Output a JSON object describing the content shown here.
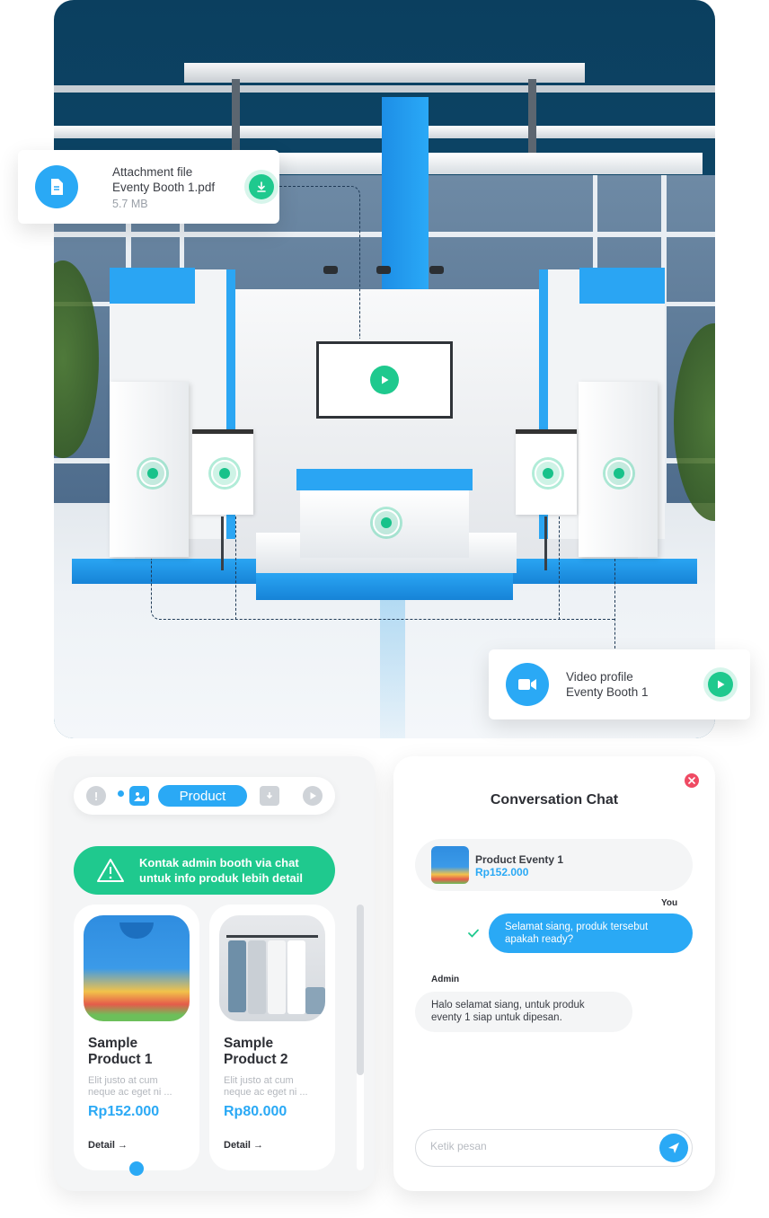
{
  "attachment_card": {
    "label": "Attachment file",
    "filename": "Eventy Booth 1.pdf",
    "size": "5.7 MB",
    "icon": "file-icon",
    "action_icon": "download-icon"
  },
  "video_card": {
    "label": "Video profile",
    "name": "Eventy Booth 1",
    "icon": "video-camera-icon",
    "action_icon": "play-icon"
  },
  "booth": {
    "hotspot_icon": "hotspot-icon",
    "video_icon": "play-icon"
  },
  "product_panel": {
    "tabs": [
      {
        "icon": "info-icon",
        "active": false
      },
      {
        "icon": "image-icon",
        "active": false
      },
      {
        "label": "Product",
        "active": true
      },
      {
        "icon": "file-download-icon",
        "active": false
      },
      {
        "icon": "play-icon",
        "active": false
      }
    ],
    "alert": {
      "icon": "warning-icon",
      "line1": "Kontak admin booth via chat",
      "line2": "untuk info produk lebih detail"
    },
    "products": [
      {
        "name_line1": "Sample",
        "name_line2": "Product 1",
        "desc_line1": "Elit justo at cum",
        "desc_line2": "neque ac eget ni ...",
        "price": "Rp152.000",
        "detail": "Detail →"
      },
      {
        "name_line1": "Sample",
        "name_line2": "Product 2",
        "desc_line1": "Elit justo at cum",
        "desc_line2": "neque ac eget ni ...",
        "price": "Rp80.000",
        "detail": "Detail →"
      }
    ]
  },
  "chat": {
    "title": "Conversation Chat",
    "product": {
      "name": "Product Eventy 1",
      "price": "Rp152.000"
    },
    "messages": [
      {
        "sender": "You",
        "line1": "Selamat siang, produk tersebut",
        "line2": "apakah ready?"
      },
      {
        "sender": "Admin",
        "line1": "Halo selamat siang, untuk produk",
        "line2": "eventy 1 siap untuk dipesan."
      }
    ],
    "input_placeholder": "Ketik pesan",
    "colors": {
      "accent": "#2aa9f5",
      "close": "#ef4a63",
      "success": "#1fc98e"
    }
  }
}
